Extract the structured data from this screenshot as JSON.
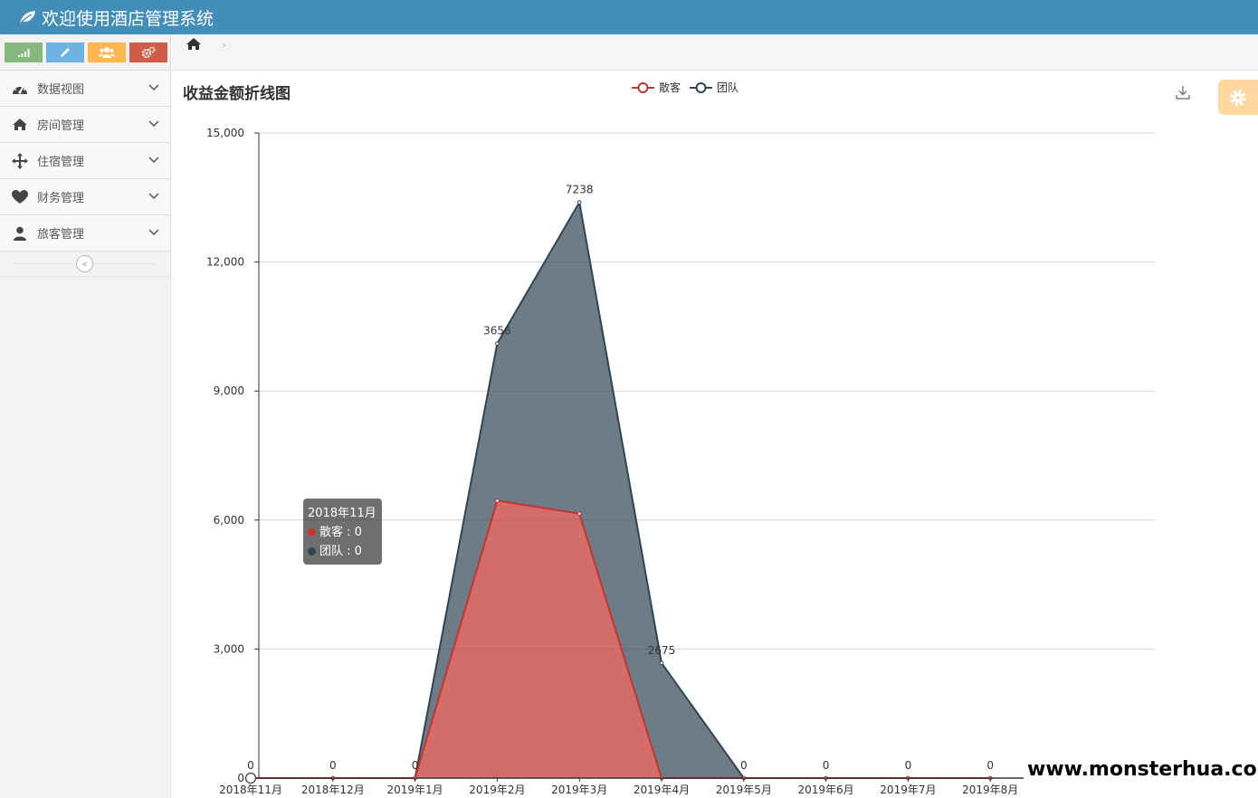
{
  "app": {
    "title": "欢迎使用酒店管理系统"
  },
  "shortcuts": [
    {
      "icon": "signal-icon",
      "color": "#87b87f"
    },
    {
      "icon": "pencil-icon",
      "color": "#6fb3e0"
    },
    {
      "icon": "users-icon",
      "color": "#ffb752"
    },
    {
      "icon": "cogs-icon",
      "color": "#d15b47"
    }
  ],
  "sidebar": {
    "items": [
      {
        "label": "数据视图",
        "icon": "dashboard-icon"
      },
      {
        "label": "房间管理",
        "icon": "home-icon"
      },
      {
        "label": "住宿管理",
        "icon": "move-icon"
      },
      {
        "label": "财务管理",
        "icon": "heart-icon"
      },
      {
        "label": "旅客管理",
        "icon": "user-icon"
      }
    ],
    "collapse_glyph": "«"
  },
  "breadcrumbs": {
    "home_icon": "home-icon",
    "separator": "›"
  },
  "tooltip": {
    "title": "2018年11月",
    "rows": [
      {
        "name": "散客",
        "value": "0",
        "color": "#c23531"
      },
      {
        "name": "团队",
        "value": "0",
        "color": "#2f4554"
      }
    ],
    "sep": " : "
  },
  "watermark": "www.monsterhua.com",
  "chart_data": {
    "type": "area",
    "stacked": true,
    "title": "收益金额折线图",
    "categories": [
      "2018年11月",
      "2018年12月",
      "2019年1月",
      "2019年2月",
      "2019年3月",
      "2019年4月",
      "2019年5月",
      "2019年6月",
      "2019年7月",
      "2019年8月"
    ],
    "series": [
      {
        "name": "散客",
        "color": "#c23531",
        "values": [
          0,
          0,
          0,
          6450,
          6150,
          0,
          0,
          0,
          0,
          0
        ]
      },
      {
        "name": "团队",
        "color": "#2f4554",
        "values": [
          0,
          0,
          0,
          3656,
          7238,
          2675,
          0,
          0,
          0,
          0
        ]
      }
    ],
    "label_series": "团队",
    "ylim": [
      0,
      15000
    ],
    "yticks": [
      0,
      3000,
      6000,
      9000,
      12000,
      15000
    ],
    "ytick_labels": [
      "0",
      "3,000",
      "6,000",
      "9,000",
      "12,000",
      "15,000"
    ],
    "grid": true,
    "legend": "top-center"
  }
}
